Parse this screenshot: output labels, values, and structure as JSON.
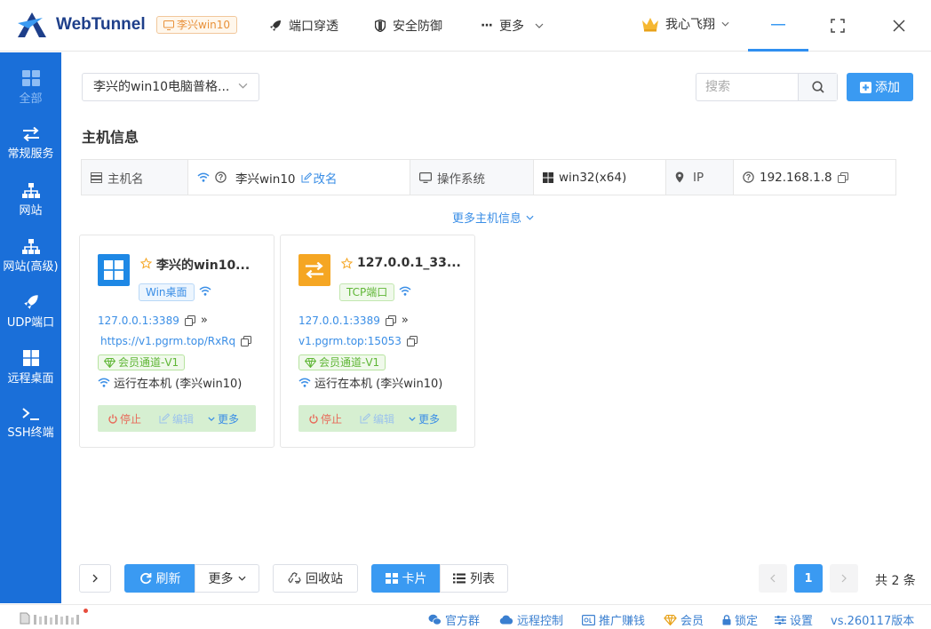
{
  "app": {
    "brand": "WebTunnel",
    "host_badge": "李兴win10"
  },
  "nav": [
    {
      "label": "端口穿透",
      "icon": "rocket-icon"
    },
    {
      "label": "安全防御",
      "icon": "shield-icon"
    },
    {
      "label": "更多",
      "icon": "ellipsis-icon"
    }
  ],
  "user": {
    "name": "我心飞翔",
    "icon": "crown-icon"
  },
  "sidebar": [
    {
      "label": "全部",
      "icon": "grid-icon",
      "active": true
    },
    {
      "label": "常规服务",
      "icon": "swap-icon"
    },
    {
      "label": "网站",
      "icon": "sitemap-icon"
    },
    {
      "label": "网站(高级)",
      "icon": "sitemap-icon"
    },
    {
      "label": "UDP端口",
      "icon": "rocket-icon"
    },
    {
      "label": "远程桌面",
      "icon": "windows-icon"
    },
    {
      "label": "SSH终端",
      "icon": "terminal-icon"
    }
  ],
  "toolbar": {
    "device_select": "李兴的win10电脑普格...",
    "search_placeholder": "搜索",
    "add_label": "添加"
  },
  "host_info": {
    "section_title": "主机信息",
    "hostname_label": "主机名",
    "hostname_value": "李兴win10",
    "rename_label": "改名",
    "os_label": "操作系统",
    "os_value": "win32(x64)",
    "ip_label": "IP",
    "ip_value": "192.168.1.8",
    "more_label": "更多主机信息"
  },
  "cards": [
    {
      "title": "李兴的win10...",
      "tag": "Win桌面",
      "local_addr": "127.0.0.1:3389",
      "public_addr": "https://v1.pgrm.top/RxRq",
      "channel": "会员通道-V1",
      "running": "运行在本机 (李兴win10)",
      "actions": {
        "stop": "停止",
        "edit": "编辑",
        "more": "更多"
      },
      "icon": "windows-icon",
      "icon_color": "#1e88e5"
    },
    {
      "title": "127.0.0.1_33...",
      "tag": "TCP端口",
      "local_addr": "127.0.0.1:3389",
      "public_addr": "v1.pgrm.top:15053",
      "channel": "会员通道-V1",
      "running": "运行在本机 (李兴win10)",
      "actions": {
        "stop": "停止",
        "edit": "编辑",
        "more": "更多"
      },
      "icon": "swap-icon",
      "icon_color": "#f5a623"
    }
  ],
  "bottom": {
    "refresh": "刷新",
    "more": "更多",
    "recycle": "回收站",
    "card_view": "卡片",
    "list_view": "列表",
    "page": "1",
    "total": "共 2 条"
  },
  "status": {
    "group": "官方群",
    "remote": "远程控制",
    "promo": "推广赚钱",
    "member": "会员",
    "lock": "锁定",
    "settings": "设置",
    "version": "vs.260117版本"
  },
  "colors": {
    "primary": "#3a9af2",
    "sidebar": "#1a6fd9",
    "brand": "#1e3f8a"
  }
}
